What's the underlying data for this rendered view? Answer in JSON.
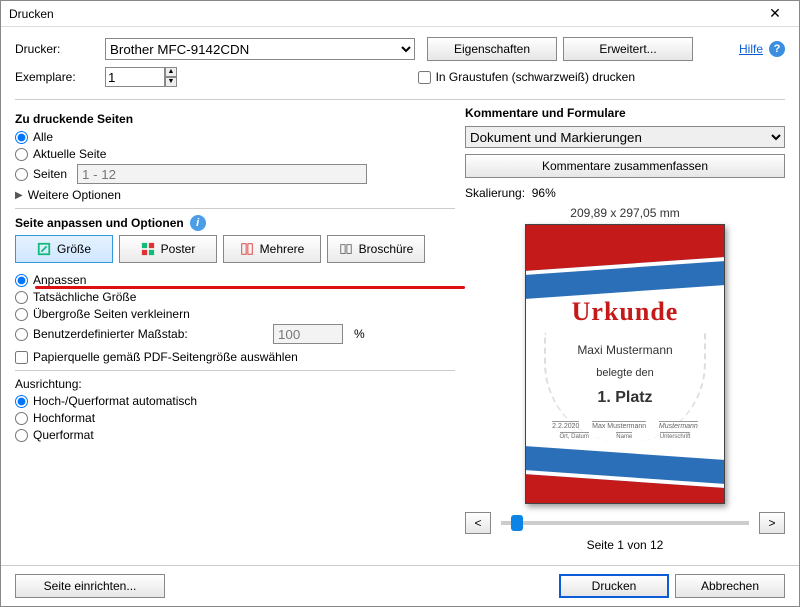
{
  "window": {
    "title": "Drucken"
  },
  "header": {
    "printer_label": "Drucker:",
    "printer_value": "Brother MFC-9142CDN",
    "properties_btn": "Eigenschaften",
    "advanced_btn": "Erweitert...",
    "help_link": "Hilfe",
    "copies_label": "Exemplare:",
    "copies_value": "1",
    "grayscale_label": "In Graustufen (schwarzweiß) drucken"
  },
  "pages": {
    "title": "Zu druckende Seiten",
    "all": "Alle",
    "current": "Aktuelle Seite",
    "range_label": "Seiten",
    "range_value": "1 - 12",
    "more_options": "Weitere Optionen"
  },
  "fit": {
    "title": "Seite anpassen und Optionen",
    "modes": [
      "Größe",
      "Poster",
      "Mehrere",
      "Broschüre"
    ],
    "fit": "Anpassen",
    "actual": "Tatsächliche Größe",
    "shrink": "Übergroße Seiten verkleinern",
    "custom_label": "Benutzerdefinierter Maßstab:",
    "custom_value": "100",
    "percent": "%",
    "papersource": "Papierquelle gemäß PDF-Seitengröße auswählen"
  },
  "orient": {
    "title": "Ausrichtung:",
    "auto": "Hoch-/Querformat automatisch",
    "portrait": "Hochformat",
    "landscape": "Querformat"
  },
  "comments": {
    "title": "Kommentare und Formulare",
    "selected": "Dokument und Markierungen",
    "summarize_btn": "Kommentare zusammenfassen"
  },
  "preview": {
    "scaling_label": "Skalierung:",
    "scaling_value": "96%",
    "dimensions": "209,89 x 297,05 mm",
    "page_counter": "Seite 1 von 12",
    "cert": {
      "heading": "Urkunde",
      "name": "Maxi Mustermann",
      "subline": "belegte den",
      "rank": "1. Platz",
      "sig_date": "2.2.2020",
      "sig_name": "Max Mustermann",
      "sig_sign": "Mustermann",
      "leg_date": "Ort, Datum",
      "leg_name": "Name",
      "leg_sign": "Unterschrift"
    }
  },
  "footer": {
    "page_setup": "Seite einrichten...",
    "print": "Drucken",
    "cancel": "Abbrechen"
  }
}
